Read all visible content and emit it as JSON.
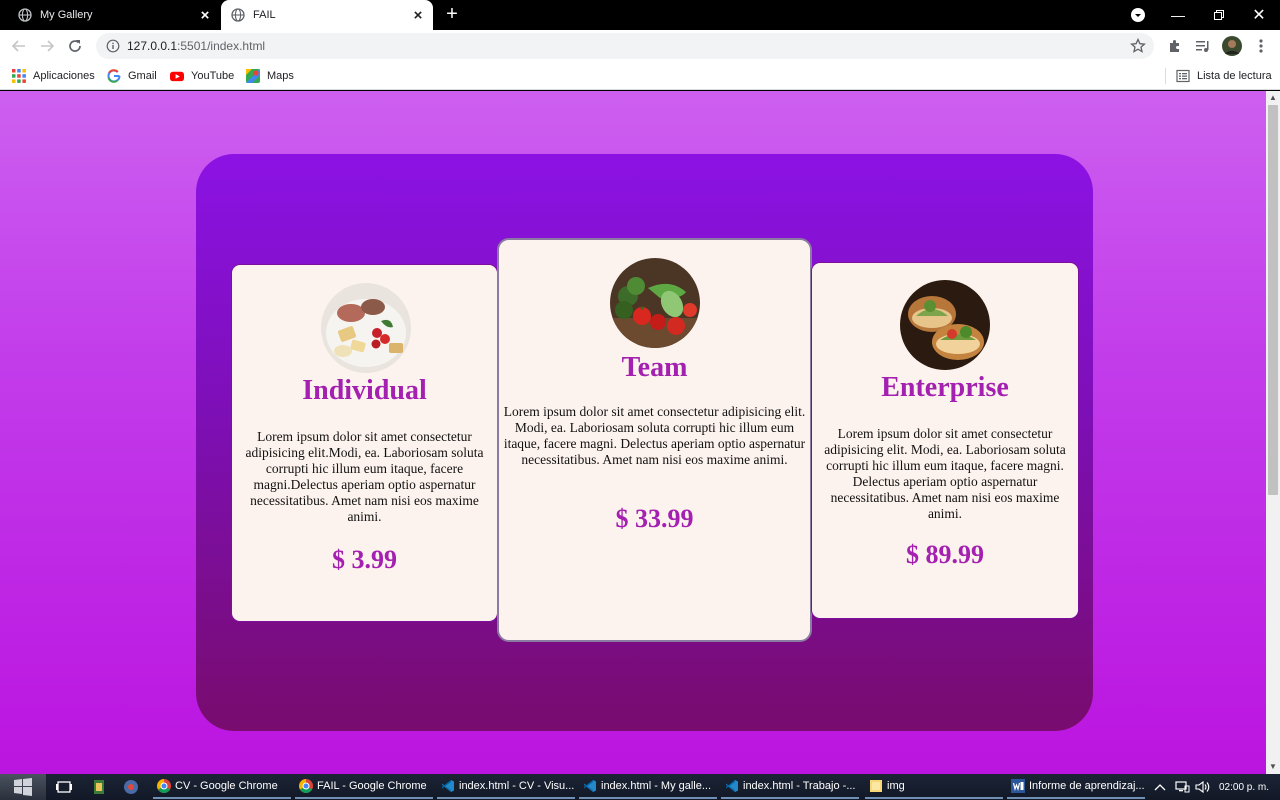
{
  "browser": {
    "tabs": [
      {
        "title": "My Gallery",
        "favicon": "globe-icon",
        "active": false
      },
      {
        "title": "FAIL",
        "favicon": "globe-icon",
        "active": true
      }
    ],
    "url_host": "127.0.0.1",
    "url_rest": ":5501/index.html",
    "bookmarks": [
      {
        "label": "Aplicaciones",
        "icon": "apps-grid-icon"
      },
      {
        "label": "Gmail",
        "icon": "google-icon"
      },
      {
        "label": "YouTube",
        "icon": "youtube-icon"
      },
      {
        "label": "Maps",
        "icon": "maps-icon"
      }
    ],
    "reading_list": "Lista de lectura"
  },
  "page": {
    "colors": {
      "background": "#c23cea",
      "panel": "#7d0fb6",
      "card": "#fdf3ee",
      "accent": "#a320b0"
    },
    "plans": [
      {
        "title": "Individual",
        "description": "Lorem ipsum dolor sit amet consectetur adipisicing elit.Modi, ea. Laboriosam soluta corrupti hic illum eum itaque, facere magni.Delectus aperiam optio aspernatur necessitatibus. Amet nam nisi eos maxime animi.",
        "price": "$ 3.99",
        "image": "food-platter-image"
      },
      {
        "title": "Team",
        "description": "Lorem ipsum dolor sit amet consectetur adipisicing elit. Modi, ea. Laboriosam soluta corrupti hic illum eum itaque, facere magni. Delectus aperiam optio aspernatur necessitatibus. Amet nam nisi eos maxime animi.",
        "price": "$ 33.99",
        "image": "vegetables-image"
      },
      {
        "title": "Enterprise",
        "description": "Lorem ipsum dolor sit amet consectetur adipisicing elit. Modi, ea. Laboriosam soluta corrupti hic illum eum itaque, facere magni. Delectus aperiam optio aspernatur necessitatibus. Amet nam nisi eos maxime animi.",
        "price": "$ 89.99",
        "image": "sandwich-image"
      }
    ]
  },
  "taskbar": {
    "tasks": [
      {
        "label": "CV - Google Chrome",
        "icon": "chrome-icon"
      },
      {
        "label": "FAIL - Google Chrome",
        "icon": "chrome-icon"
      },
      {
        "label": "index.html - CV - Visu...",
        "icon": "vscode-icon"
      },
      {
        "label": "index.html - My galle...",
        "icon": "vscode-icon"
      },
      {
        "label": "index.html - Trabajo -...",
        "icon": "vscode-icon"
      },
      {
        "label": "img",
        "icon": "folder-icon"
      },
      {
        "label": "Informe de aprendizaj...",
        "icon": "word-icon"
      }
    ],
    "clock": "02:00 p. m."
  }
}
